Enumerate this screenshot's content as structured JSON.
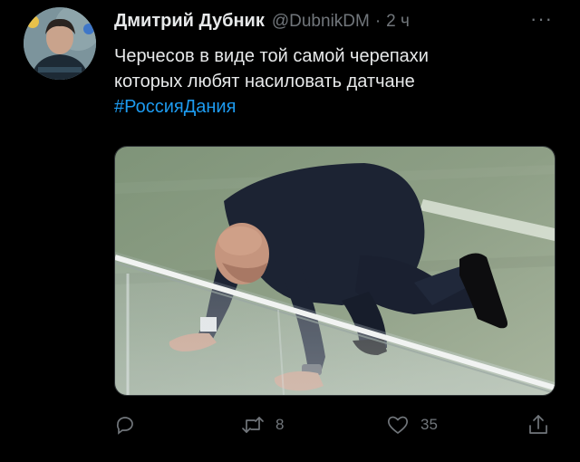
{
  "author": {
    "name": "Дмитрий Дубник",
    "handle": "@DubnikDM",
    "separator": "·",
    "time": "2 ч"
  },
  "more_label": "···",
  "tweet": {
    "line1": "Черчесов в виде той самой черепахи",
    "line2": "которых любят насиловать датчане",
    "hashtag": "#РоссияДания"
  },
  "stats": {
    "retweets": "8",
    "likes": "35"
  },
  "icons": {
    "reply": "reply-icon",
    "retweet": "retweet-icon",
    "like": "heart-icon",
    "share": "share-icon",
    "more": "more-icon"
  },
  "colors": {
    "background": "#000000",
    "text": "#e7e9ea",
    "muted": "#71767b",
    "hashtag": "#1d9bf0"
  }
}
